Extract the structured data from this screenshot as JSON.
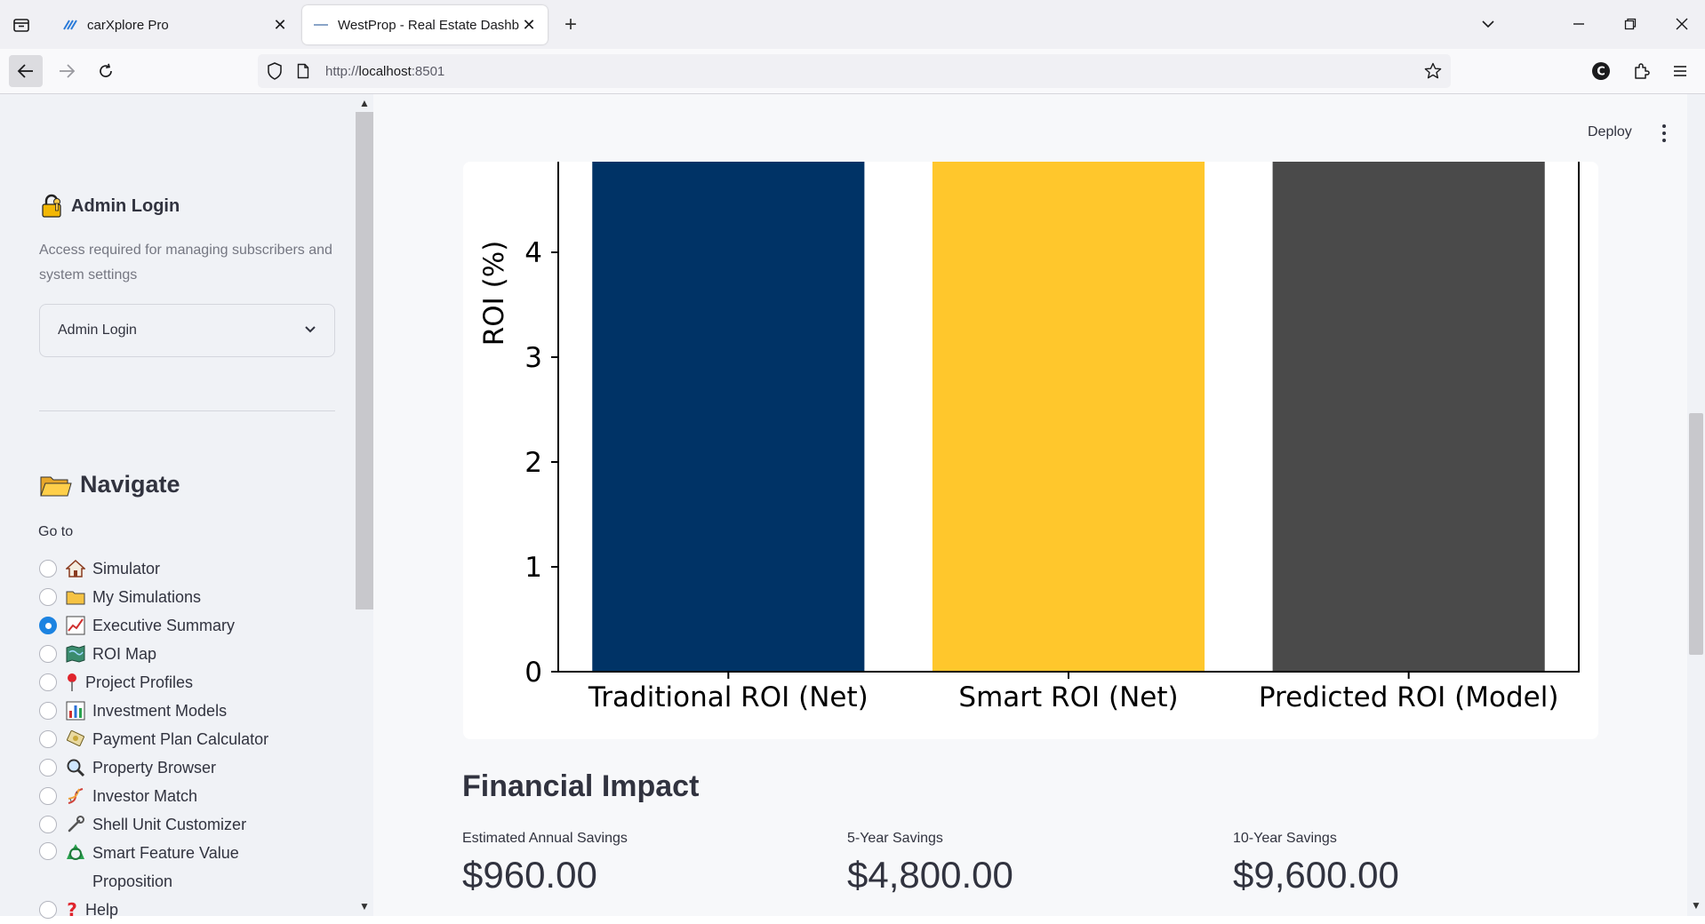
{
  "browser": {
    "tabs": [
      {
        "title": "carXplore Pro",
        "active": false
      },
      {
        "title": "WestProp - Real Estate Dashboard",
        "active": true
      }
    ],
    "url_prefix": "http://",
    "url_host": "localhost",
    "url_port": ":8501"
  },
  "sidebar": {
    "login_heading": "Admin Login",
    "login_desc": "Access required for managing subscribers and system settings",
    "login_select_value": "Admin Login",
    "nav_heading": "Navigate",
    "goto_label": "Go to",
    "items": [
      {
        "label": "Simulator",
        "icon": "house-icon",
        "selected": false
      },
      {
        "label": "My Simulations",
        "icon": "folder-icon",
        "selected": false
      },
      {
        "label": "Executive Summary",
        "icon": "chart-up-icon",
        "selected": true
      },
      {
        "label": "ROI Map",
        "icon": "map-icon",
        "selected": false
      },
      {
        "label": "Project Profiles",
        "icon": "pin-icon",
        "selected": false
      },
      {
        "label": "Investment Models",
        "icon": "bar-chart-icon",
        "selected": false
      },
      {
        "label": "Payment Plan Calculator",
        "icon": "money-icon",
        "selected": false
      },
      {
        "label": "Property Browser",
        "icon": "magnifier-icon",
        "selected": false
      },
      {
        "label": "Investor Match",
        "icon": "dna-icon",
        "selected": false
      },
      {
        "label": "Shell Unit Customizer",
        "icon": "wrench-icon",
        "selected": false
      },
      {
        "label": "Smart Feature Value Proposition",
        "icon": "recycle-icon",
        "selected": false
      },
      {
        "label": "Help",
        "icon": "question-icon",
        "selected": false
      }
    ]
  },
  "header": {
    "deploy_label": "Deploy"
  },
  "colors": {
    "traditional": "#003366",
    "smart": "#ffc72c",
    "predicted": "#4a4a4a",
    "accent": "#1c83e1"
  },
  "chart_data": {
    "type": "bar",
    "categories": [
      "Traditional ROI (Net)",
      "Smart ROI (Net)",
      "Predicted ROI (Model)"
    ],
    "values": [
      4.9,
      4.9,
      4.9
    ],
    "ylabel": "ROI (%)",
    "yticks": [
      0,
      1,
      2,
      3,
      4
    ],
    "ylim": [
      0,
      4.9
    ],
    "grid": false
  },
  "financial": {
    "title": "Financial Impact",
    "metrics": [
      {
        "label": "Estimated Annual Savings",
        "value": "$960.00"
      },
      {
        "label": "5-Year Savings",
        "value": "$4,800.00"
      },
      {
        "label": "10-Year Savings",
        "value": "$9,600.00"
      }
    ]
  }
}
